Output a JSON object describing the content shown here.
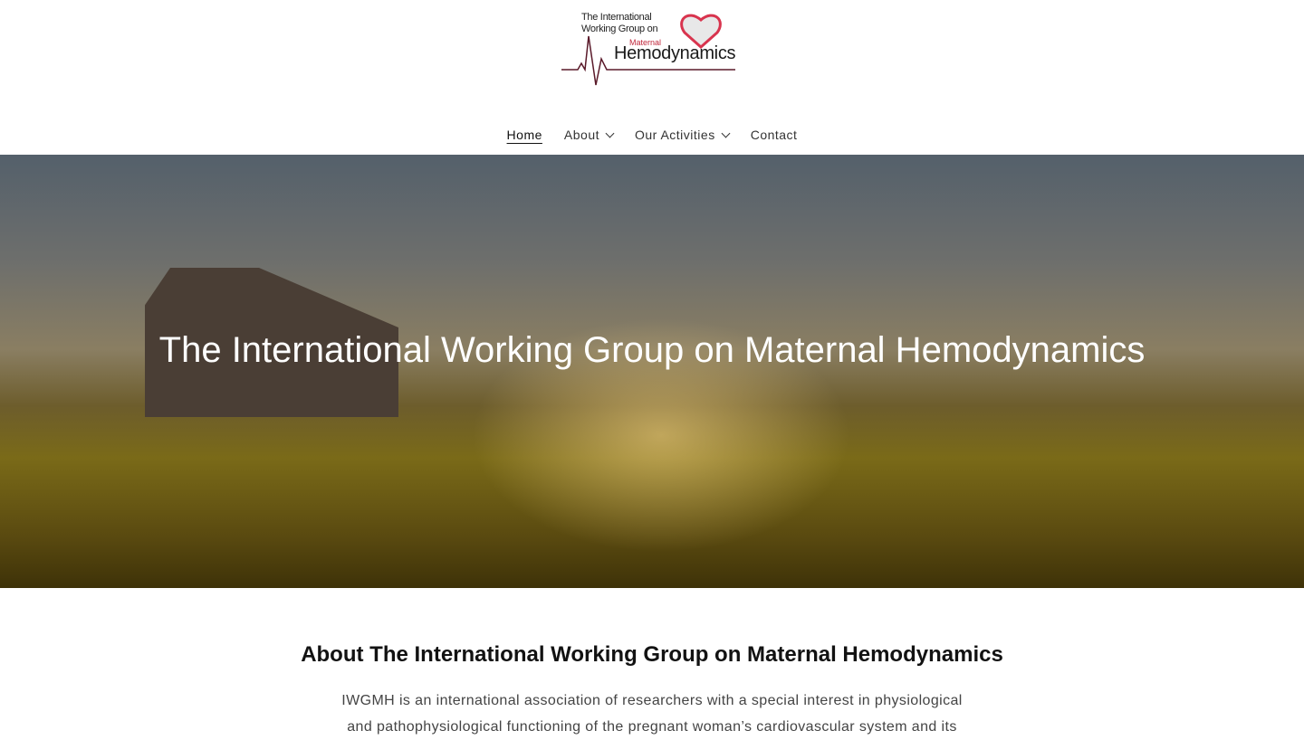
{
  "logo": {
    "line1": "The International",
    "line2": "Working Group on",
    "line3": "Maternal",
    "line4": "Hemodynamics"
  },
  "nav": {
    "items": [
      {
        "label": "Home"
      },
      {
        "label": "About"
      },
      {
        "label": "Our Activities"
      },
      {
        "label": "Contact"
      }
    ]
  },
  "hero": {
    "title": "The International Working Group on Maternal Hemodynamics"
  },
  "about": {
    "heading": "About The International Working Group on Maternal Hemodynamics",
    "text": "IWGMH is an international association of researchers with a special interest in physiological and pathophysiological functioning of the pregnant woman’s cardiovascular system and its"
  },
  "colors": {
    "accent": "#c0273b",
    "line": "#5a1a2a"
  }
}
